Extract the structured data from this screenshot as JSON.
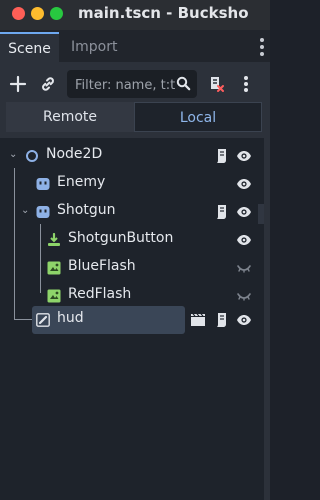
{
  "window": {
    "title": "main.tscn - Bucksho"
  },
  "dock": {
    "tabs": [
      {
        "label": "Scene"
      },
      {
        "label": "Import"
      }
    ]
  },
  "toolbar": {
    "filter_placeholder": "Filter: name, t:t"
  },
  "view_toggle": {
    "remote_label": "Remote",
    "local_label": "Local",
    "selected": "Local"
  },
  "tree": {
    "nodes": [
      {
        "name": "Node2D",
        "depth": 0,
        "icon": "node2d-circle-icon",
        "expanded": true,
        "script": true,
        "visible": true
      },
      {
        "name": "Enemy",
        "depth": 1,
        "icon": "sprite-icon",
        "script": false,
        "visible": true
      },
      {
        "name": "Shotgun",
        "depth": 1,
        "icon": "sprite-icon",
        "expanded": true,
        "script": true,
        "visible": true
      },
      {
        "name": "ShotgunButton",
        "depth": 2,
        "icon": "touch-button-icon",
        "script": false,
        "visible": true
      },
      {
        "name": "BlueFlash",
        "depth": 2,
        "icon": "animated-sprite-icon",
        "script": false,
        "visible": false
      },
      {
        "name": "RedFlash",
        "depth": 2,
        "icon": "animated-sprite-icon",
        "script": false,
        "visible": false
      },
      {
        "name": "hud",
        "depth": 1,
        "icon": "canvas-layer-icon",
        "script": true,
        "visible": true,
        "instance": true,
        "selected": true
      }
    ]
  },
  "colors": {
    "accent": "#6ea8f0",
    "panel": "#2c313a",
    "tree_bg": "#1e232b",
    "selected_row": "#3a4657"
  }
}
